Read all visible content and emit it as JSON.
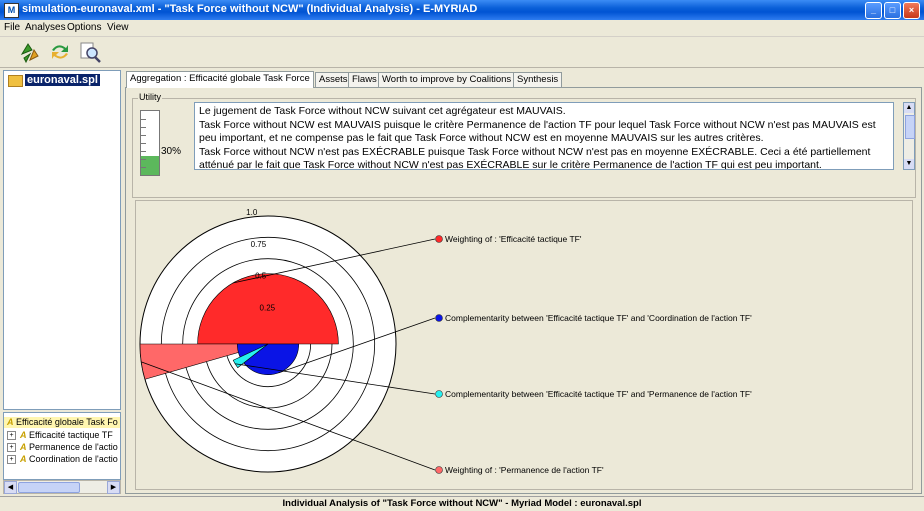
{
  "window": {
    "title": "simulation-euronaval.xml - \"Task Force without NCW\" (Individual Analysis) - E-MYRIAD",
    "app_icon": "M"
  },
  "menu": {
    "items": [
      "File",
      "Analyses",
      "Options",
      "View"
    ]
  },
  "toolbar": {
    "buttons": [
      "recycle-arrows-icon",
      "refresh-arrows-icon",
      "magnifier-icon"
    ]
  },
  "tree": {
    "root_label": "euronaval.spl"
  },
  "criteria_list": {
    "items": [
      {
        "prefix": "A",
        "label": "Efficacité globale Task Fo",
        "expandable": false
      },
      {
        "prefix": "A",
        "label": "Efficacité tactique TF",
        "expandable": true
      },
      {
        "prefix": "A",
        "label": "Permanence de l'actio",
        "expandable": true
      },
      {
        "prefix": "A",
        "label": "Coordination de l'actio",
        "expandable": true
      }
    ]
  },
  "tabs": [
    {
      "label": "Aggregation : Efficacité globale Task Force",
      "active": true
    },
    {
      "label": "Assets",
      "active": false
    },
    {
      "label": "Flaws",
      "active": false
    },
    {
      "label": "Worth to improve by Coalitions",
      "active": false
    },
    {
      "label": "Synthesis",
      "active": false
    }
  ],
  "utility": {
    "label": "Utility",
    "percent_text": "30%",
    "level": 0.3,
    "colors": {
      "fill": "#5cb85c"
    }
  },
  "explanation": {
    "lines": [
      "Le jugement de Task Force without NCW suivant cet agrégateur est MAUVAIS.",
      "Task Force without NCW est MAUVAIS puisque le critère Permanence de l'action TF pour lequel Task Force without NCW n'est pas MAUVAIS est",
      "peu important, et ne compense pas le fait que Task Force without NCW est en moyenne MAUVAIS sur les autres critères.",
      "Task Force without NCW n'est pas EXÉCRABLE puisque Task Force without NCW n'est pas en moyenne EXÉCRABLE. Ceci a été partiellement",
      "atténué par le fait que Task Force without NCW n'est pas EXÉCRABLE sur le critère Permanence de l'action TF qui est peu important."
    ]
  },
  "chart_data": {
    "type": "polar-area",
    "radial_ticks": [
      "0.25",
      "0.5",
      "0.75",
      "1.0"
    ],
    "series": [
      {
        "name": "Weighting of : 'Efficacité tactique TF'",
        "value": 0.55,
        "color": "#ff2a2a",
        "start_deg": 0,
        "end_deg": 180
      },
      {
        "name": "Complementarity between 'Efficacité tactique TF' and 'Coordination de l'action TF'",
        "value": 0.24,
        "color": "#0a14e6",
        "start_deg": 180,
        "end_deg": 360
      },
      {
        "name": "Complementarity between 'Efficacité tactique TF' and 'Permanence de l'action TF'",
        "value": 0.3,
        "color": "#27f0f0",
        "start_deg": 205,
        "end_deg": 218
      },
      {
        "name": "Weighting of : 'Permanence de l'action TF'",
        "value": 1.0,
        "color": "#ff6868",
        "start_deg": 180,
        "end_deg": 196
      }
    ]
  },
  "status": {
    "text": "Individual Analysis of \"Task Force without NCW\" - Myriad Model : euronaval.spl"
  }
}
